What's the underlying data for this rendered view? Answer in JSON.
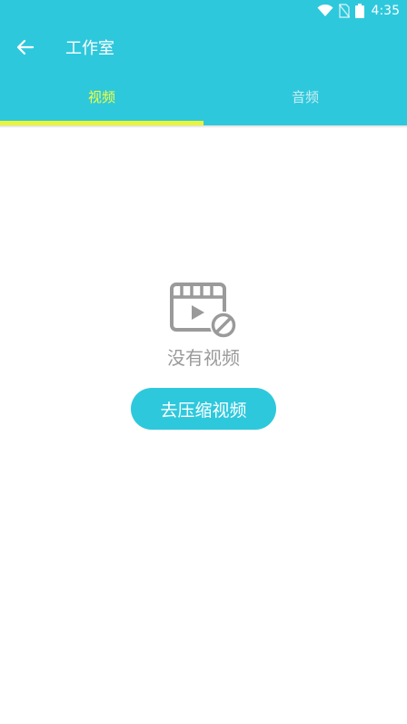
{
  "status_bar": {
    "time": "4:35",
    "icons": [
      "wifi-icon",
      "no-sim-icon",
      "battery-icon"
    ]
  },
  "toolbar": {
    "back_icon": "arrow-left-icon",
    "title": "工作室"
  },
  "tabs": [
    {
      "label": "视频",
      "active": true
    },
    {
      "label": "音频",
      "active": false
    }
  ],
  "empty_state": {
    "icon": "video-off-icon",
    "message": "没有视频",
    "button_label": "去压缩视频"
  },
  "colors": {
    "primary": "#2ec8dc",
    "tab_active_text": "#f2ff3c",
    "tab_indicator": "#eaf53a",
    "empty_text": "#9a9a9a"
  }
}
